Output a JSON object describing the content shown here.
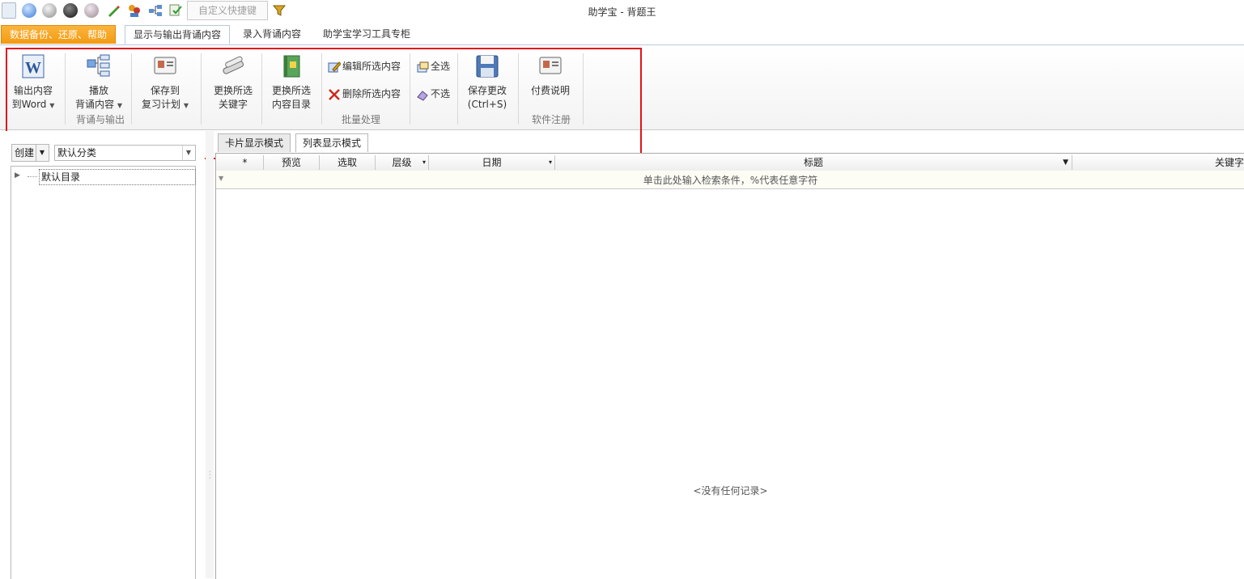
{
  "window": {
    "title": "助学宝 - 背题王"
  },
  "quick_access": {
    "custom_shortcut_placeholder": "自定义快捷键"
  },
  "ribbon_tabs": {
    "backup": "数据备份、还原、帮助",
    "display": "显示与输出背诵内容",
    "input": "录入背诵内容",
    "tools": "助学宝学习工具专柜"
  },
  "ribbon": {
    "export_word": {
      "line1": "输出内容",
      "line2": "到Word"
    },
    "play": {
      "line1": "播放",
      "line2": "背诵内容"
    },
    "save_to": {
      "line1": "保存到",
      "line2": "复习计划"
    },
    "group_recite_output": "背诵与输出",
    "replace_keywords": {
      "line1": "更换所选",
      "line2": "关键字"
    },
    "replace_dir": {
      "line1": "更换所选",
      "line2": "内容目录"
    },
    "edit_selected": "编辑所选内容",
    "delete_selected": "删除所选内容",
    "select_all": "全选",
    "deselect": "不选",
    "save_changes": {
      "line1": "保存更改",
      "line2": "(Ctrl+S)"
    },
    "group_batch": "批量处理",
    "pay_info": "付费说明",
    "group_register": "软件注册"
  },
  "left_panel": {
    "create_label": "创建",
    "category_value": "默认分类",
    "tree_root": "默认目录"
  },
  "view_tabs": {
    "card": "卡片显示模式",
    "list": "列表显示模式"
  },
  "grid": {
    "columns": [
      "*",
      "预览",
      "选取",
      "层级",
      "日期",
      "标题",
      "关键字"
    ],
    "filter_hint": "单击此处输入检索条件，%代表任意字符",
    "empty_message": "<没有任何记录>"
  },
  "colors": {
    "accent_orange": "#f39a11",
    "highlight_red": "#e0141c"
  }
}
